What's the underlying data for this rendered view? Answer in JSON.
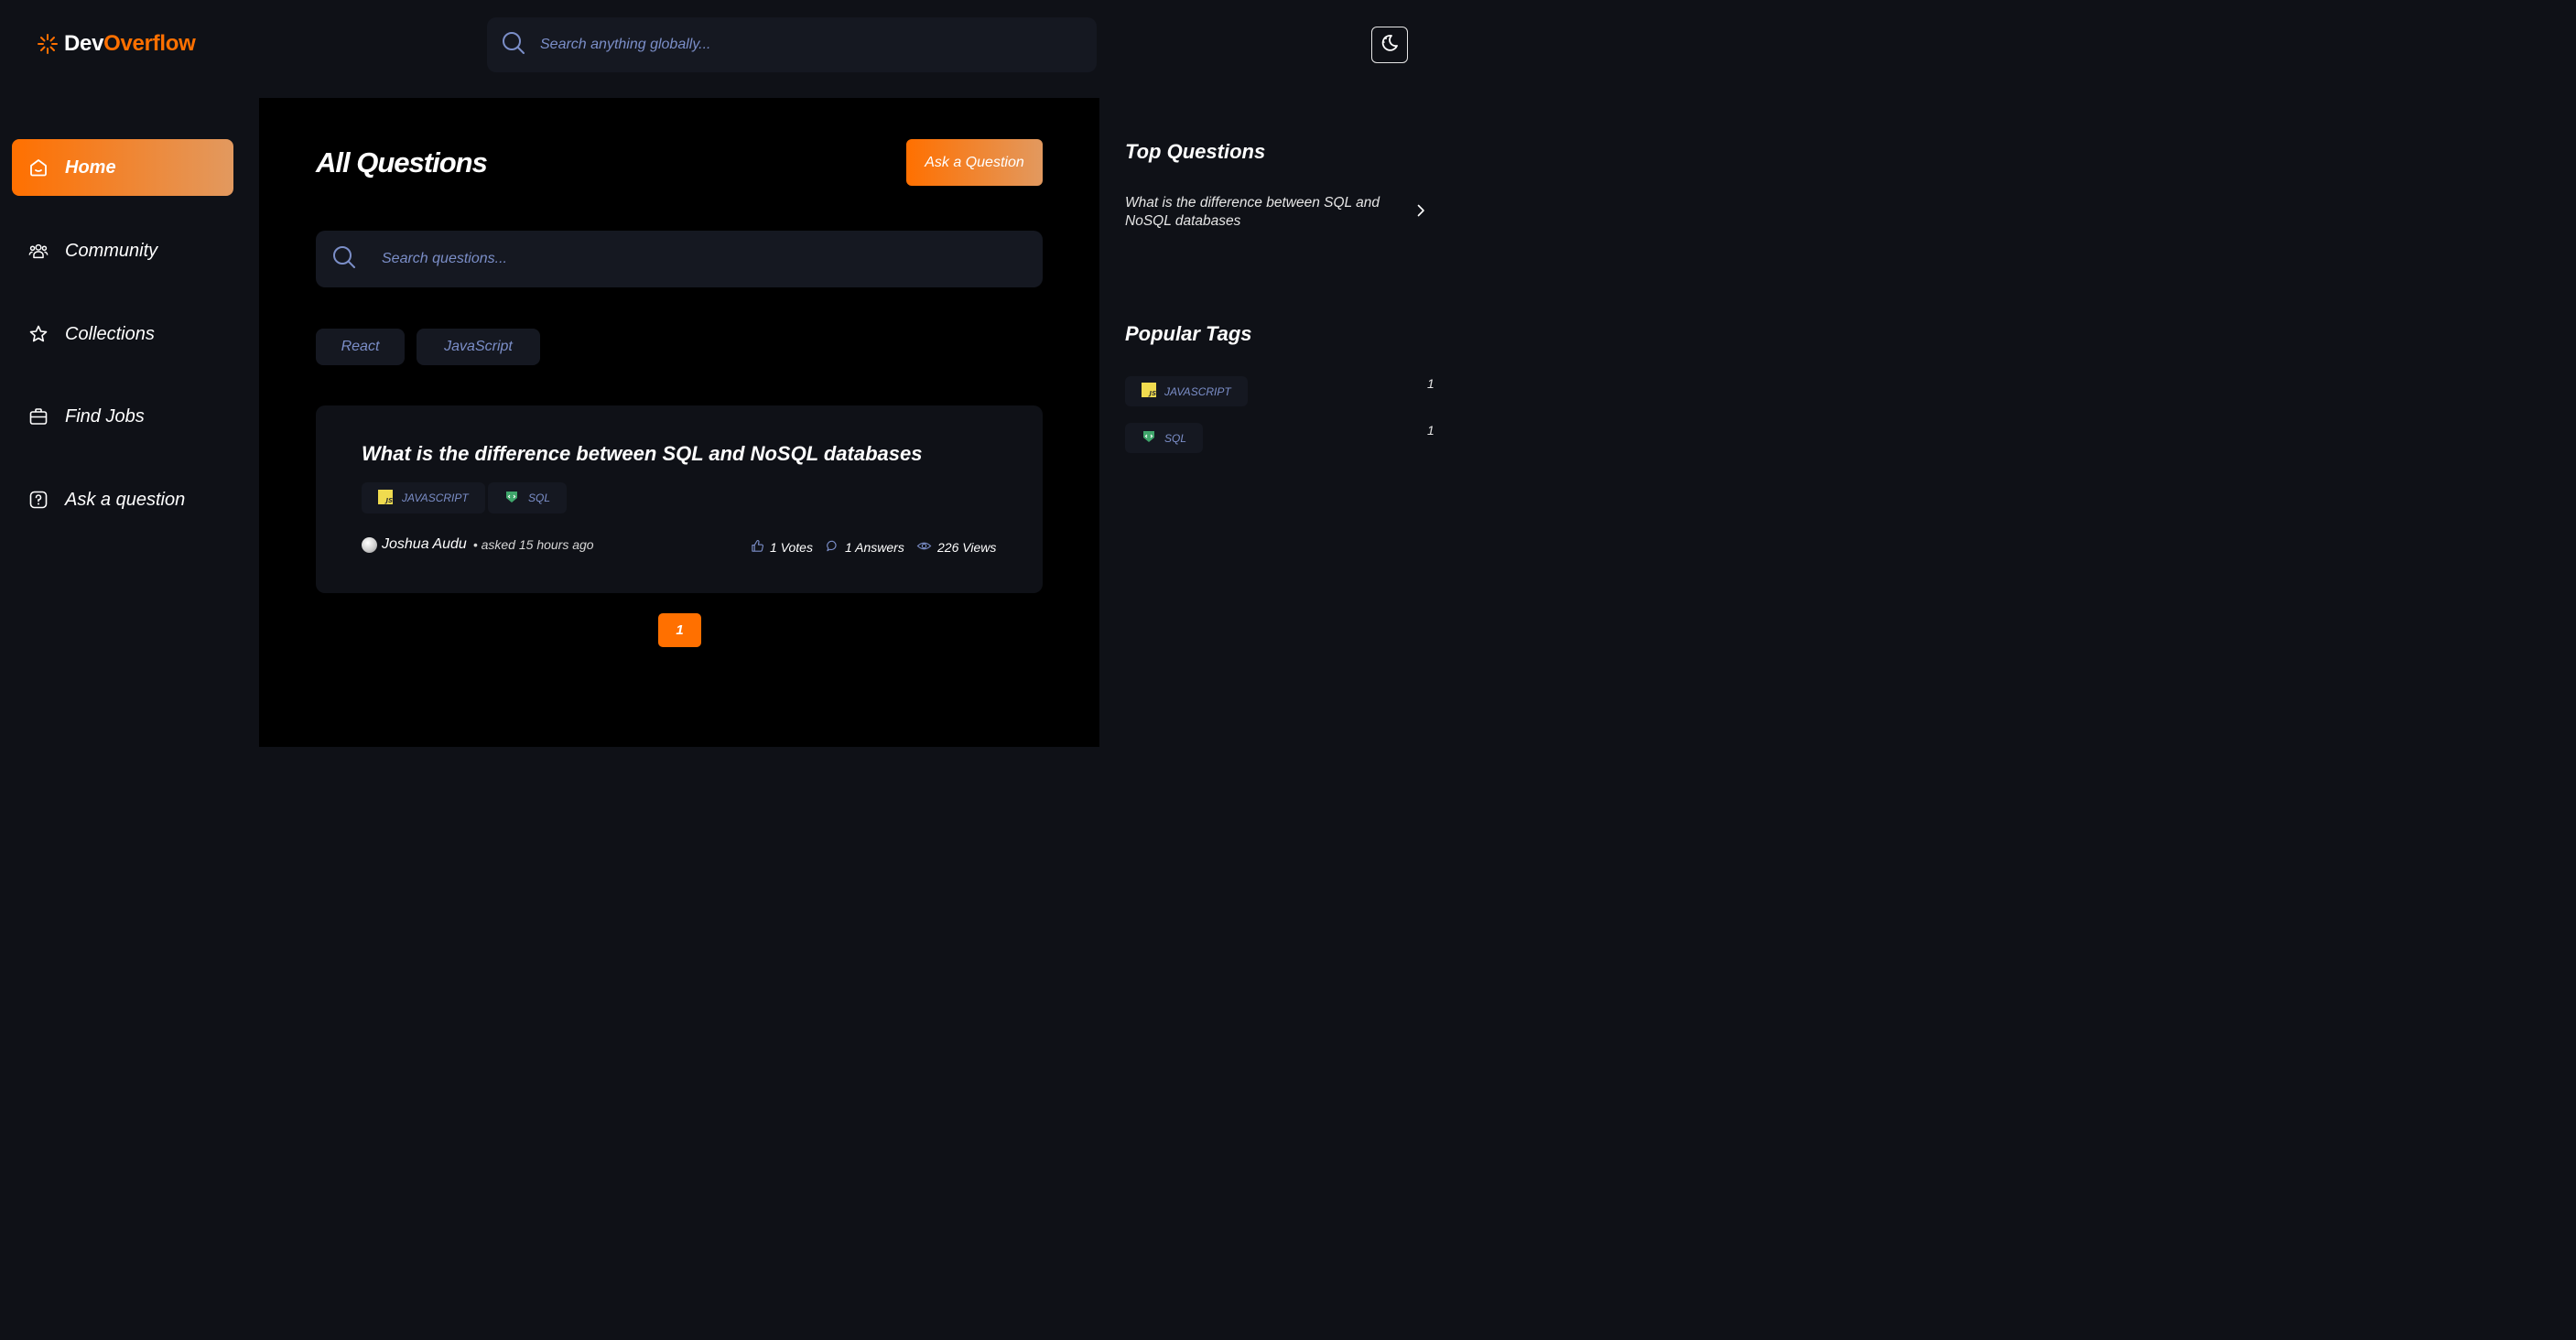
{
  "header": {
    "logo_dev": "Dev",
    "logo_overflow": "Overflow",
    "global_search_placeholder": "Search anything globally...",
    "theme_icon": "moon-icon"
  },
  "sidebar": {
    "items": [
      {
        "label": "Home",
        "icon": "home-icon",
        "active": true
      },
      {
        "label": "Community",
        "icon": "users-icon",
        "active": false
      },
      {
        "label": "Collections",
        "icon": "star-icon",
        "active": false
      },
      {
        "label": "Find Jobs",
        "icon": "briefcase-icon",
        "active": false
      },
      {
        "label": "Ask a question",
        "icon": "question-icon",
        "active": false
      }
    ]
  },
  "main": {
    "title": "All Questions",
    "ask_button": "Ask a Question",
    "search_placeholder": "Search questions...",
    "filters": [
      "React",
      "JavaScript"
    ],
    "questions": [
      {
        "title": "What is the difference between SQL and NoSQL databases",
        "tags": [
          "JAVASCRIPT",
          "SQL"
        ],
        "author": "Joshua Audu",
        "asked": "• asked 15 hours ago",
        "votes": "1 Votes",
        "answers": "1 Answers",
        "views": "226 Views"
      }
    ],
    "pagination": {
      "current": "1"
    }
  },
  "right_sidebar": {
    "top_questions_heading": "Top Questions",
    "top_questions": [
      "What is the difference between SQL and NoSQL databases"
    ],
    "popular_tags_heading": "Popular Tags",
    "popular_tags": [
      {
        "name": "JAVASCRIPT",
        "count": "1"
      },
      {
        "name": "SQL",
        "count": "1"
      }
    ]
  },
  "colors": {
    "background": "#0f1117",
    "main_background": "#000000",
    "surface": "#151821",
    "accent": "#ff7000",
    "accent_gradient_end": "#e2995f",
    "muted_text": "#7b8ec8"
  }
}
